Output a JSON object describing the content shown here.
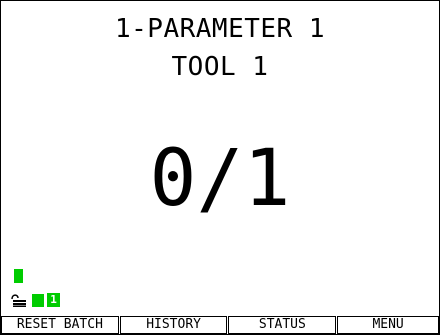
{
  "header": {
    "title": "1-PARAMETER 1",
    "subtitle": "TOOL 1"
  },
  "counter": {
    "text": "0/1"
  },
  "indicators": {
    "badge_number": "1",
    "status_color": "#00cc00",
    "lock_icon": "unlocked-padlock-icon"
  },
  "softkeys": {
    "reset_batch": "RESET BATCH",
    "history": "HISTORY",
    "status": "STATUS",
    "menu": "MENU"
  }
}
